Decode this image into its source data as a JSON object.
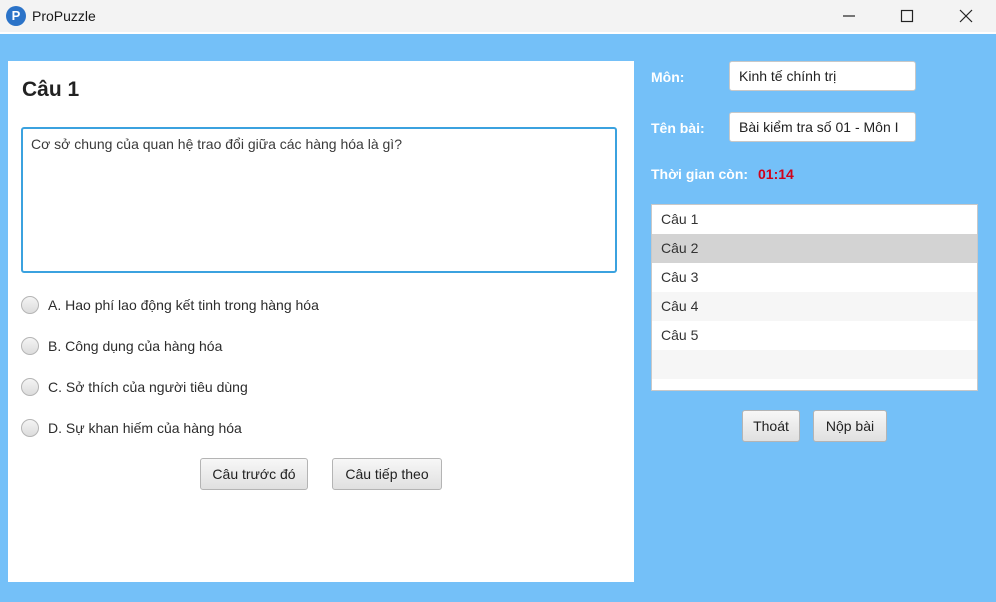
{
  "window": {
    "title": "ProPuzzle",
    "icon_letter": "P",
    "controls": [
      "minimize-icon",
      "maximize-icon",
      "close-icon"
    ]
  },
  "question": {
    "title": "Câu 1",
    "text": "Cơ sở chung của quan hệ trao đổi giữa các hàng hóa là gì?",
    "options": [
      "A. Hao phí lao động kết tinh trong hàng hóa",
      "B. Công dụng của hàng hóa",
      "C. Sở thích của người tiêu dùng",
      "D. Sự khan hiếm của hàng hóa"
    ],
    "prev_label": "Câu trước đó",
    "next_label": "Câu tiếp theo"
  },
  "sidebar": {
    "subject_label": "Môn:",
    "subject_value": "Kinh tế chính trị",
    "test_label": "Tên bài:",
    "test_value": "Bài kiểm tra số 01 - Môn I",
    "time_label": "Thời gian còn:",
    "time_value": "01:14",
    "questions": [
      "Câu 1",
      "Câu 2",
      "Câu 3",
      "Câu 4",
      "Câu 5"
    ],
    "selected_question": "Câu 2",
    "exit_label": "Thoát",
    "submit_label": "Nộp bài"
  },
  "colors": {
    "background": "#74c0f8",
    "timer": "#d0021b",
    "focus_border": "#3ba2df"
  }
}
